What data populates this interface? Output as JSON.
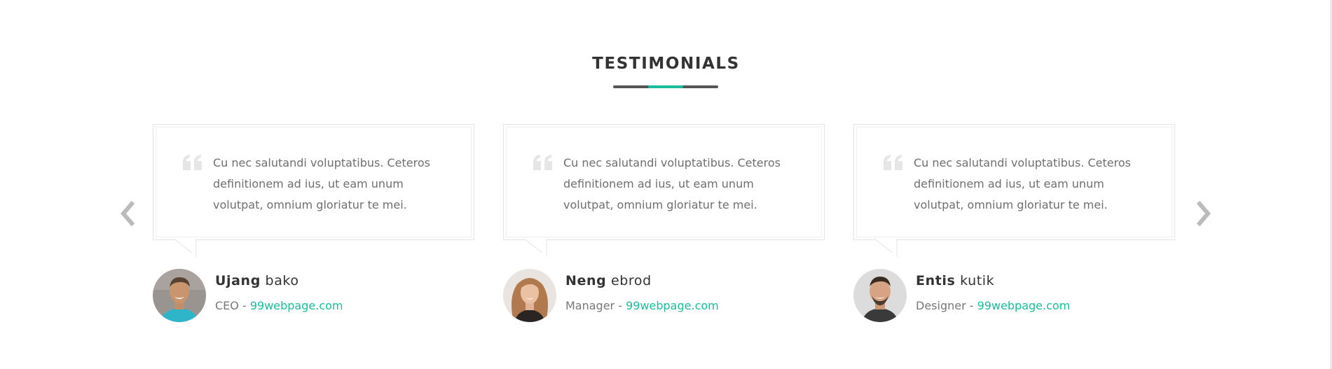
{
  "section": {
    "title": "TESTIMONIALS"
  },
  "colors": {
    "accent": "#1abc9c",
    "underline": "#555555",
    "text_body": "#6f6f6f",
    "text_heading": "#333333",
    "arrow": "#bbbbbb",
    "quote_icon": "#e6e6e6"
  },
  "icons": {
    "prev": "chevron-left-icon",
    "next": "chevron-right-icon",
    "quote": "quote-icon"
  },
  "testimonials": [
    {
      "quote": "Cu nec salutandi voluptatibus. Ceteros definitionem ad ius, ut eam unum volutpat, omnium gloriatur te mei.",
      "first_name": "Ujang",
      "last_name": "bako",
      "role": "CEO - ",
      "link": "99webpage.com"
    },
    {
      "quote": "Cu nec salutandi voluptatibus. Ceteros definitionem ad ius, ut eam unum volutpat, omnium gloriatur te mei.",
      "first_name": "Neng",
      "last_name": "ebrod",
      "role": "Manager - ",
      "link": "99webpage.com"
    },
    {
      "quote": "Cu nec salutandi voluptatibus. Ceteros definitionem ad ius, ut eam unum volutpat, omnium gloriatur te mei.",
      "first_name": "Entis",
      "last_name": "kutik",
      "role": "Designer - ",
      "link": "99webpage.com"
    }
  ]
}
